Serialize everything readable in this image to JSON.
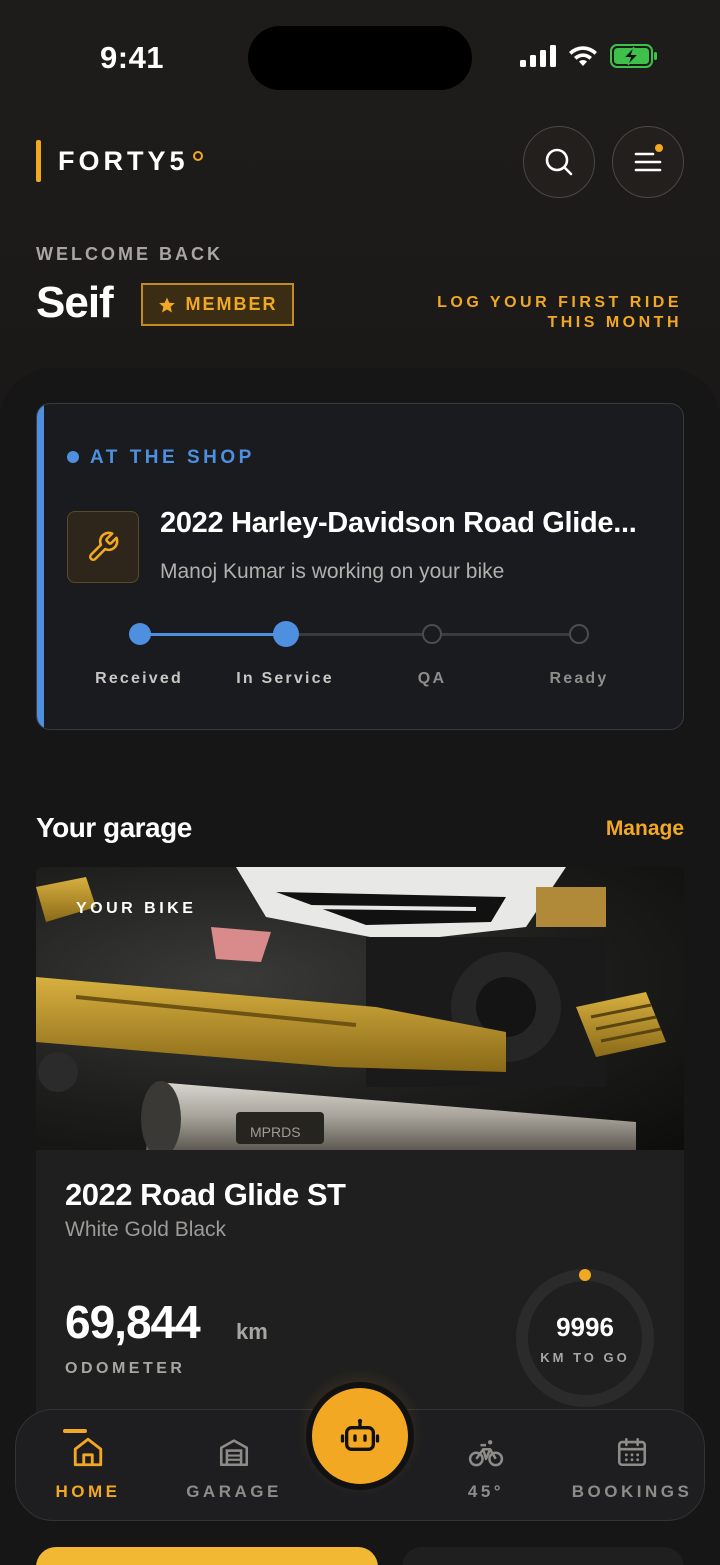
{
  "status_bar": {
    "time": "9:41"
  },
  "header": {
    "brand": "FORTY5",
    "welcome": "WELCOME BACK",
    "user_name": "Seif",
    "member_badge": "MEMBER",
    "ride_prompt_line1": "LOG YOUR FIRST RIDE",
    "ride_prompt_line2": "THIS MONTH",
    "search_icon": "search-icon",
    "menu_icon": "menu-icon"
  },
  "shop_card": {
    "label": "AT THE SHOP",
    "title": "2022 Harley-Davidson Road Glide...",
    "subtitle": "Manoj Kumar is working on your bike",
    "icon": "wrench-icon",
    "steps": [
      "Received",
      "In Service",
      "QA",
      "Ready"
    ],
    "current_step": 2
  },
  "garage": {
    "title": "Your garage",
    "manage": "Manage",
    "bike": {
      "badge": "YOUR BIKE",
      "name": "2022 Road Glide ST",
      "colorway": "White Gold Black",
      "odometer_value": "69,844",
      "odometer_unit": "km",
      "odometer_label": "ODOMETER",
      "service_remaining": "9996",
      "service_remaining_label": "KM TO GO",
      "service_progress": 0.0004
    }
  },
  "nav": {
    "items": [
      {
        "label": "HOME",
        "icon": "home-icon",
        "active": true
      },
      {
        "label": "GARAGE",
        "icon": "garage-icon",
        "active": false
      },
      {
        "label": "45°",
        "icon": "bicycle-icon",
        "active": false
      },
      {
        "label": "BOOKINGS",
        "icon": "calendar-icon",
        "active": false
      }
    ],
    "center_action_icon": "robot-icon"
  },
  "colors": {
    "accent": "#f2a822",
    "shop_blue": "#4e8fe0",
    "background": "#161616"
  }
}
